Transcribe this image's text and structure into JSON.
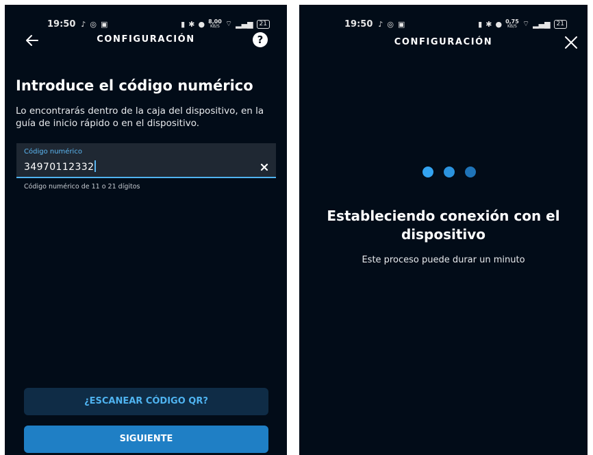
{
  "left_screen": {
    "status_bar": {
      "time": "19:50",
      "speed_value": "8,00",
      "speed_unit": "KB/S",
      "battery": "21"
    },
    "topbar": {
      "title": "CONFIGURACIÓN"
    },
    "heading": "Introduce el código numérico",
    "description": "Lo encontrarás dentro de la caja del dispositivo, en la guía de inicio rápido o en el dispositivo.",
    "field": {
      "label": "Código numérico",
      "value": "34970112332"
    },
    "helper": "Código numérico de 11 o 21 dígitos",
    "scan_button": "¿ESCANEAR CÓDIGO QR?",
    "next_button": "SIGUIENTE"
  },
  "right_screen": {
    "status_bar": {
      "time": "19:50",
      "speed_value": "0,75",
      "speed_unit": "KB/S",
      "battery": "21"
    },
    "topbar": {
      "title": "CONFIGURACIÓN"
    },
    "title": "Estableciendo conexión con el dispositivo",
    "subtitle": "Este proceso puede durar un minuto"
  },
  "icons": {
    "back": "arrow-left-icon",
    "help": "question-circle-icon",
    "clear": "close-x-icon",
    "close": "close-icon",
    "loading": "three-dots-loading"
  },
  "colors": {
    "background": "#020c18",
    "accent": "#4fb3f0",
    "primary_button": "#1f7fc5",
    "secondary_button": "#0f2c46",
    "field_background": "#1f2833"
  }
}
